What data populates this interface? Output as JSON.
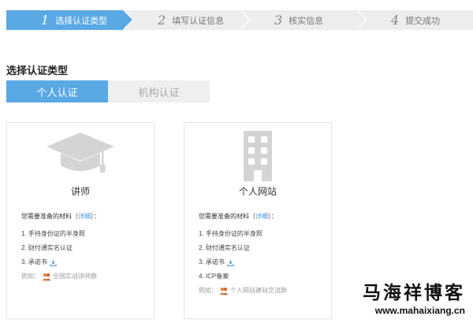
{
  "steps": [
    {
      "num": "1",
      "label": "选择认证类型",
      "active": true
    },
    {
      "num": "2",
      "label": "填写认证信息",
      "active": false
    },
    {
      "num": "3",
      "label": "核实信息",
      "active": false
    },
    {
      "num": "4",
      "label": "提交成功",
      "active": false
    }
  ],
  "section_title": "选择认证类型",
  "tabs": {
    "personal": "个人认证",
    "org": "机构认证"
  },
  "cards": [
    {
      "title": "讲师",
      "icon": "graduation-cap-icon",
      "needs_prefix": "您需要准备的材料（",
      "needs_link": "详细",
      "needs_suffix": "）：",
      "items": [
        "1. 手持身份证的半身照",
        "2. 财付通实名认证",
        "3. 承诺书"
      ],
      "example_prefix": "例如：",
      "example_text": "全国实战讲师群"
    },
    {
      "title": "个人网站",
      "icon": "building-icon",
      "needs_prefix": "您需要准备的材料（",
      "needs_link": "详细",
      "needs_suffix": "）：",
      "items": [
        "1. 手持身份证的半身照",
        "2. 财付通实名认证",
        "3. 承诺书",
        "4. ICP备案"
      ],
      "example_prefix": "例如：",
      "example_text": "个人网站建站交流群"
    }
  ],
  "watermark": {
    "cn": "马海祥博客",
    "url": "www.mahaixiang.cn"
  },
  "colors": {
    "accent": "#5aa8e4",
    "inactive_tab": "#efefef",
    "link": "#4a90d9"
  }
}
